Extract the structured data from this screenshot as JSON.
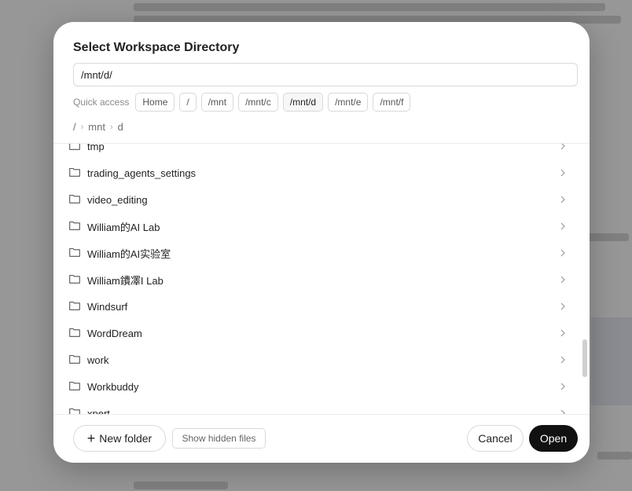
{
  "dialog": {
    "title": "Select Workspace Directory",
    "path_value": "/mnt/d/",
    "quick_access": {
      "label": "Quick access",
      "chips": [
        {
          "label": "Home",
          "active": false
        },
        {
          "label": "/",
          "active": false
        },
        {
          "label": "/mnt",
          "active": false
        },
        {
          "label": "/mnt/c",
          "active": false
        },
        {
          "label": "/mnt/d",
          "active": true
        },
        {
          "label": "/mnt/e",
          "active": false
        },
        {
          "label": "/mnt/f",
          "active": false
        }
      ]
    },
    "breadcrumb": [
      "/",
      "mnt",
      "d"
    ],
    "folders": [
      "tmp",
      "trading_agents_settings",
      "video_editing",
      "William的AI Lab",
      "William的AI实验室",
      "William鐨凙I Lab",
      "Windsurf",
      "WordDream",
      "work",
      "Workbuddy",
      "xpert"
    ],
    "footer": {
      "new_folder_label": "New folder",
      "show_hidden_label": "Show hidden files",
      "cancel_label": "Cancel",
      "open_label": "Open"
    }
  },
  "icons": {
    "folder": "folder-icon",
    "chevron": "chevron-right-icon",
    "plus": "plus-icon"
  },
  "colors": {
    "primary_button": "#111111",
    "overlay": "rgba(0,0,0,0.38)"
  }
}
